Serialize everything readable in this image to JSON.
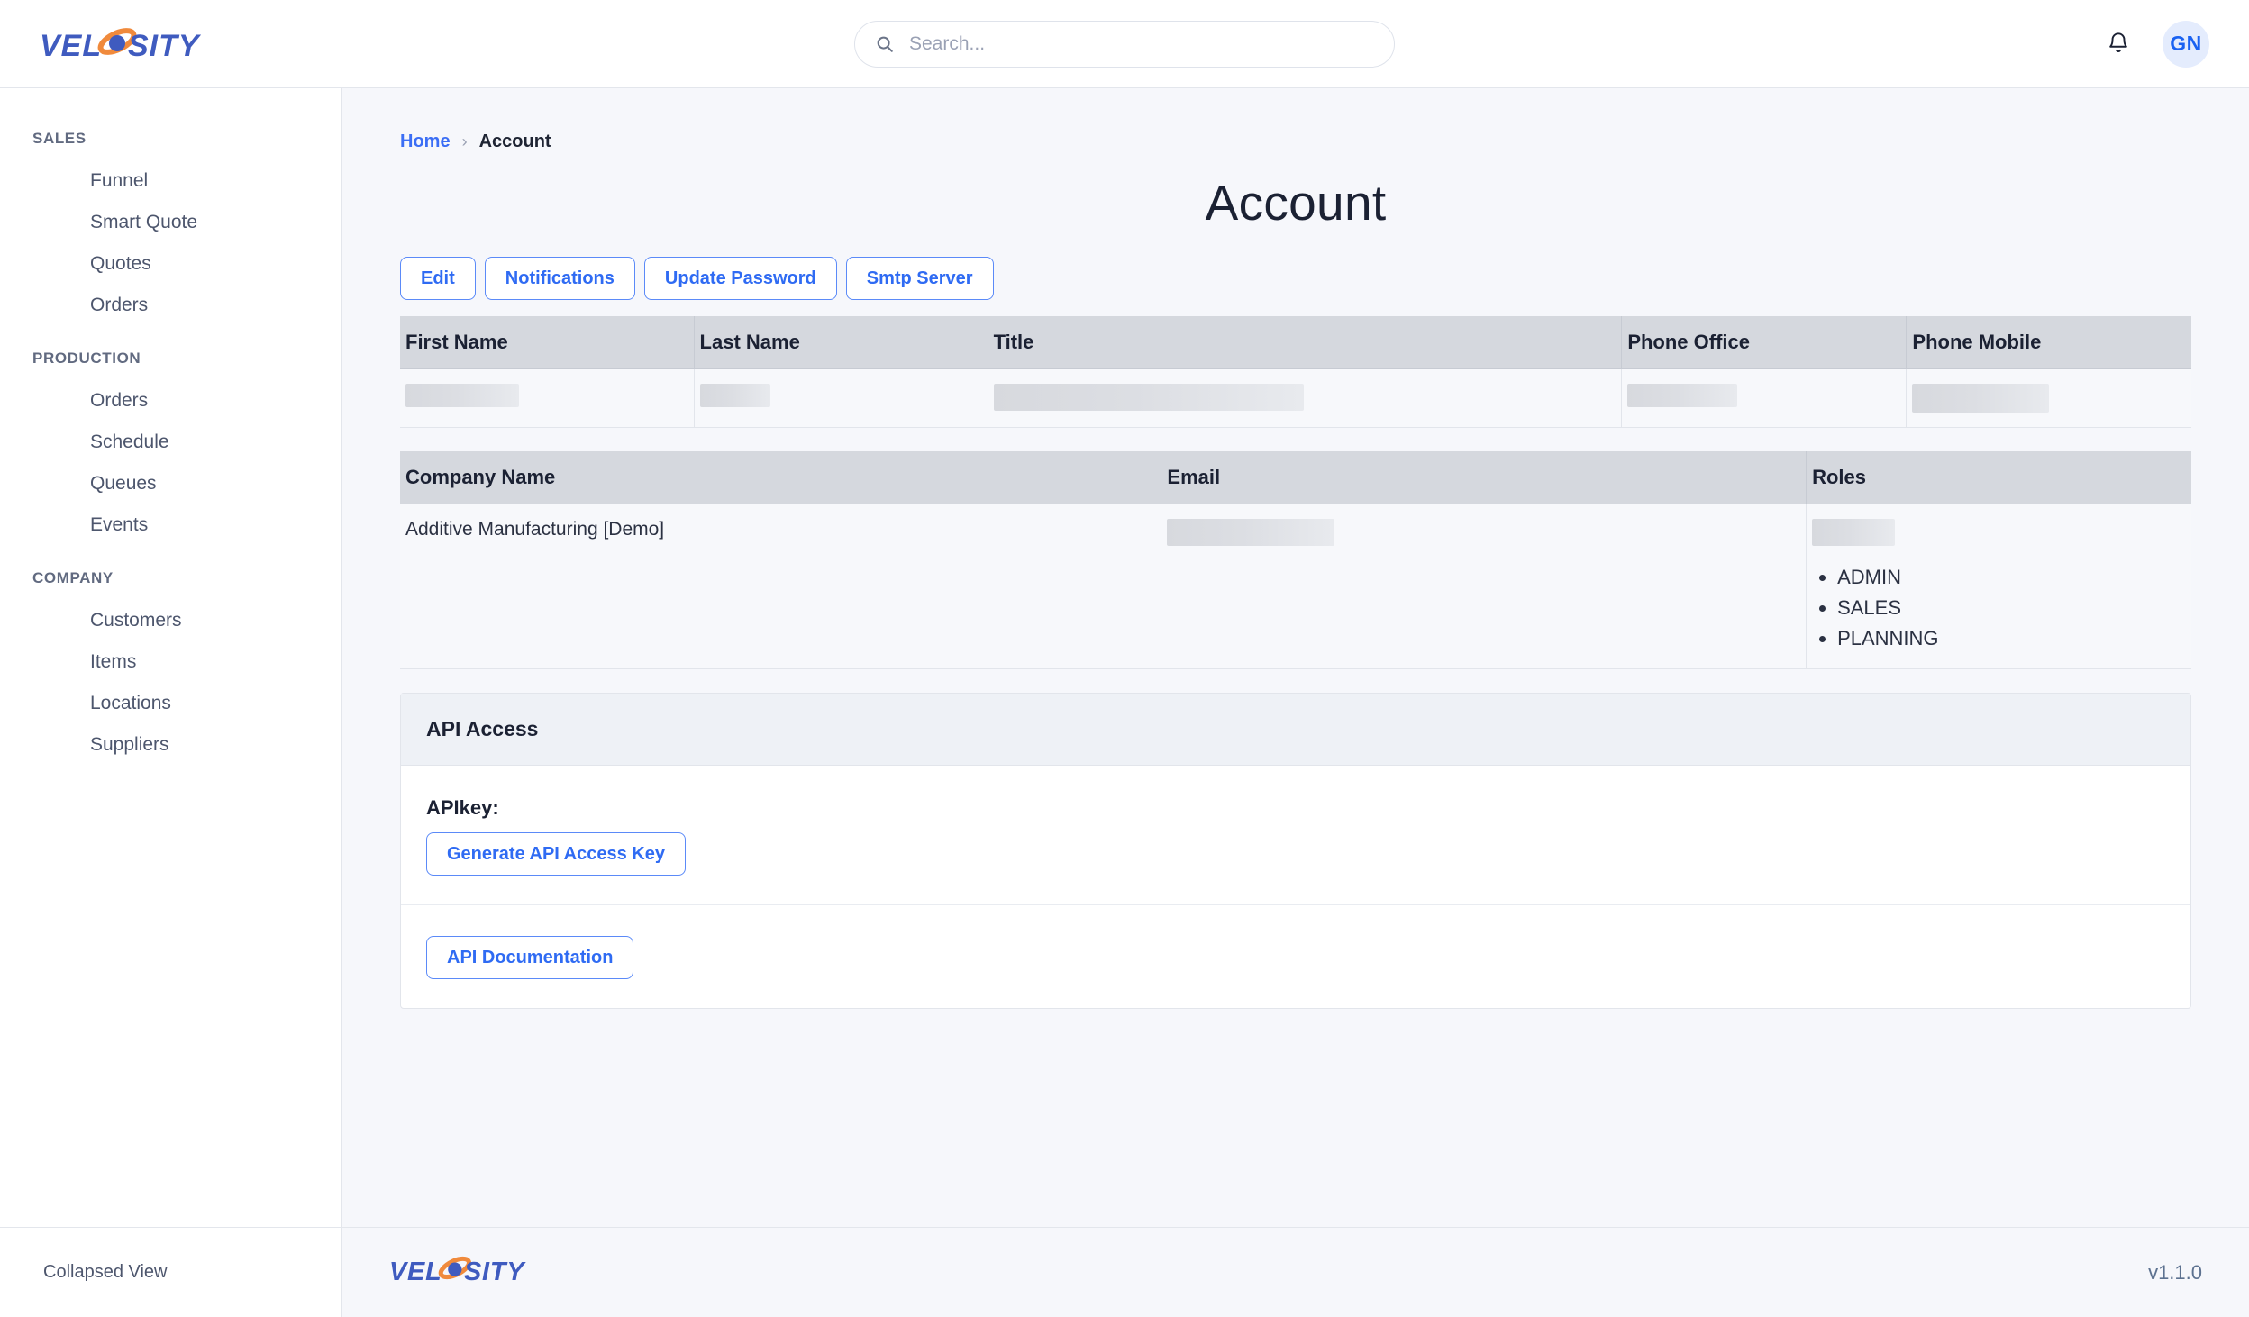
{
  "brand": {
    "name": "VELOSITY",
    "text_before": "VEL",
    "text_after": "SITY",
    "primary_color": "#3f5bbf",
    "accent_color": "#f08a3c"
  },
  "topbar": {
    "search": {
      "icon": "search-icon",
      "value": "",
      "placeholder": "Search..."
    },
    "notifications_icon": "bell-icon",
    "avatar": {
      "initials": "GN",
      "bg": "#e4ecfd",
      "fg": "#1a62f2"
    }
  },
  "sidebar": {
    "groups": [
      {
        "title": "SALES",
        "items": [
          {
            "label": "Funnel"
          },
          {
            "label": "Smart Quote"
          },
          {
            "label": "Quotes"
          },
          {
            "label": "Orders"
          }
        ]
      },
      {
        "title": "PRODUCTION",
        "items": [
          {
            "label": "Orders"
          },
          {
            "label": "Schedule"
          },
          {
            "label": "Queues"
          },
          {
            "label": "Events"
          }
        ]
      },
      {
        "title": "COMPANY",
        "items": [
          {
            "label": "Customers"
          },
          {
            "label": "Items"
          },
          {
            "label": "Locations"
          },
          {
            "label": "Suppliers"
          }
        ]
      }
    ],
    "footer_label": "Collapsed View"
  },
  "breadcrumb": {
    "home": "Home",
    "separator": "›",
    "current": "Account"
  },
  "page": {
    "title": "Account"
  },
  "actions": [
    {
      "label": "Edit"
    },
    {
      "label": "Notifications"
    },
    {
      "label": "Update Password"
    },
    {
      "label": "Smtp Server"
    }
  ],
  "profile_table": {
    "columns": [
      "First Name",
      "Last Name",
      "Title",
      "Phone Office",
      "Phone Mobile"
    ],
    "row": {
      "first_name": "",
      "last_name": "",
      "title": "",
      "phone_office": "",
      "phone_mobile": ""
    }
  },
  "company_table": {
    "columns": [
      "Company Name",
      "Email",
      "Roles"
    ],
    "row": {
      "company_name": "Additive Manufacturing [Demo]",
      "email": "",
      "role_header": "",
      "roles": [
        "ADMIN",
        "SALES",
        "PLANNING"
      ]
    }
  },
  "api_access": {
    "header": "API Access",
    "api_key_label": "APIkey:",
    "api_key_value": "",
    "generate_button": "Generate API Access Key",
    "documentation_button": "API Documentation"
  },
  "footer": {
    "version": "v1.1.0"
  }
}
